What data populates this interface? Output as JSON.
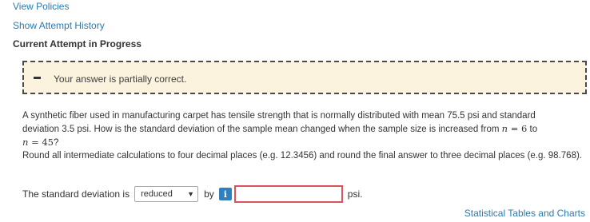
{
  "nav": {
    "view_policies": "View Policies",
    "show_attempt_history": "Show Attempt History",
    "current_attempt": "Current Attempt in Progress"
  },
  "feedback": {
    "message": "Your answer is partially correct.",
    "icon": "minus-icon",
    "background": "#fbf3dd"
  },
  "question": {
    "line1": "A synthetic fiber used in manufacturing carpet has tensile strength that is normally distributed with mean 75.5 psi and standard",
    "line2_text": "deviation 3.5 psi. How is the standard deviation of the sample mean changed when the sample size is increased from",
    "n1_var": "n",
    "n1_eq": " = 6",
    "line2_to": " to",
    "n2_var": "n",
    "n2_eq": " = 45",
    "q_mark": "?",
    "rounding": "Round all intermediate calculations to four decimal places (e.g. 12.3456) and round the final answer to three decimal places (e.g. 98.768)."
  },
  "answer": {
    "label": "The standard deviation is",
    "select_value": "reduced",
    "by_label": "by",
    "info_label": "i",
    "input_value": "",
    "unit": "psi."
  },
  "footer": {
    "stat_tables": "Statistical Tables and Charts"
  },
  "colors": {
    "link": "#2a7ab0",
    "input_border": "#d9545a",
    "info_button": "#2f7fc1"
  }
}
